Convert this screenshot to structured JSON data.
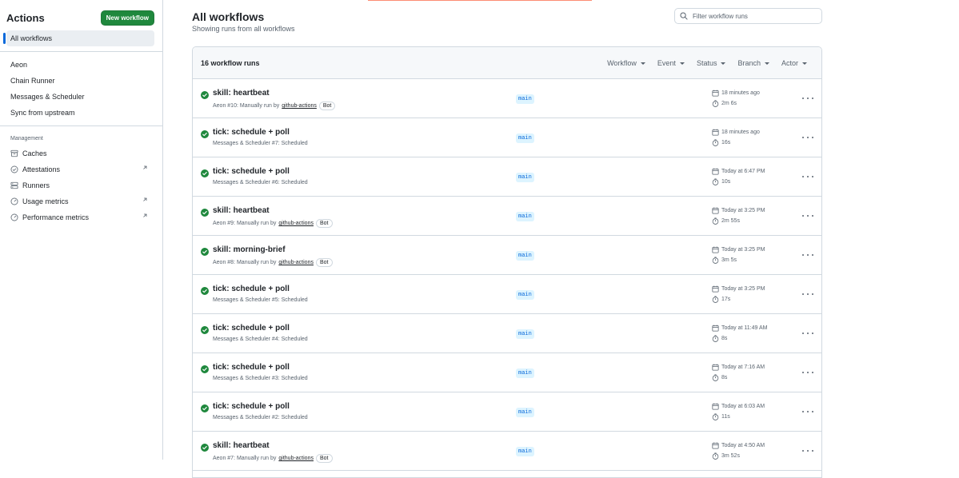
{
  "sidebar": {
    "title": "Actions",
    "new_workflow_label": "New workflow",
    "all_workflows_label": "All workflows",
    "workflows": [
      {
        "label": "Aeon"
      },
      {
        "label": "Chain Runner"
      },
      {
        "label": "Messages & Scheduler"
      },
      {
        "label": "Sync from upstream"
      }
    ],
    "management_title": "Management",
    "management": [
      {
        "label": "Caches",
        "icon": "archive-icon",
        "external": false
      },
      {
        "label": "Attestations",
        "icon": "verified-icon",
        "external": true
      },
      {
        "label": "Runners",
        "icon": "server-icon",
        "external": false
      },
      {
        "label": "Usage metrics",
        "icon": "meter-icon",
        "external": true
      },
      {
        "label": "Performance metrics",
        "icon": "meter-icon",
        "external": true
      }
    ]
  },
  "main": {
    "title": "All workflows",
    "subtitle": "Showing runs from all workflows",
    "filter_placeholder": "Filter workflow runs",
    "runs_count": "16 workflow runs",
    "filters": [
      "Workflow",
      "Event",
      "Status",
      "Branch",
      "Actor"
    ],
    "runs": [
      {
        "title": "skill: heartbeat",
        "meta": "Aeon #10: Manually run by",
        "actor": "github-actions",
        "badge": "Bot",
        "branch": "main",
        "time": "18 minutes ago",
        "duration": "2m 6s",
        "status": "success"
      },
      {
        "title": "tick: schedule + poll",
        "meta": "Messages & Scheduler #7: Scheduled",
        "actor": "",
        "badge": "",
        "branch": "main",
        "time": "18 minutes ago",
        "duration": "16s",
        "status": "success"
      },
      {
        "title": "tick: schedule + poll",
        "meta": "Messages & Scheduler #6: Scheduled",
        "actor": "",
        "badge": "",
        "branch": "main",
        "time": "Today at 6:47 PM",
        "duration": "10s",
        "status": "success"
      },
      {
        "title": "skill: heartbeat",
        "meta": "Aeon #9: Manually run by",
        "actor": "github-actions",
        "badge": "Bot",
        "branch": "main",
        "time": "Today at 3:25 PM",
        "duration": "2m 55s",
        "status": "success"
      },
      {
        "title": "skill: morning-brief",
        "meta": "Aeon #8: Manually run by",
        "actor": "github-actions",
        "badge": "Bot",
        "branch": "main",
        "time": "Today at 3:25 PM",
        "duration": "3m 5s",
        "status": "success"
      },
      {
        "title": "tick: schedule + poll",
        "meta": "Messages & Scheduler #5: Scheduled",
        "actor": "",
        "badge": "",
        "branch": "main",
        "time": "Today at 3:25 PM",
        "duration": "17s",
        "status": "success"
      },
      {
        "title": "tick: schedule + poll",
        "meta": "Messages & Scheduler #4: Scheduled",
        "actor": "",
        "badge": "",
        "branch": "main",
        "time": "Today at 11:49 AM",
        "duration": "8s",
        "status": "success"
      },
      {
        "title": "tick: schedule + poll",
        "meta": "Messages & Scheduler #3: Scheduled",
        "actor": "",
        "badge": "",
        "branch": "main",
        "time": "Today at 7:16 AM",
        "duration": "8s",
        "status": "success"
      },
      {
        "title": "tick: schedule + poll",
        "meta": "Messages & Scheduler #2: Scheduled",
        "actor": "",
        "badge": "",
        "branch": "main",
        "time": "Today at 6:03 AM",
        "duration": "11s",
        "status": "success"
      },
      {
        "title": "skill: heartbeat",
        "meta": "Aeon #7: Manually run by",
        "actor": "github-actions",
        "badge": "Bot",
        "branch": "main",
        "time": "Today at 4:50 AM",
        "duration": "3m 52s",
        "status": "success"
      }
    ]
  },
  "colors": {
    "accent": "#0969da",
    "success": "#1f883d",
    "border": "#d1d9e0",
    "muted": "#59636e"
  }
}
